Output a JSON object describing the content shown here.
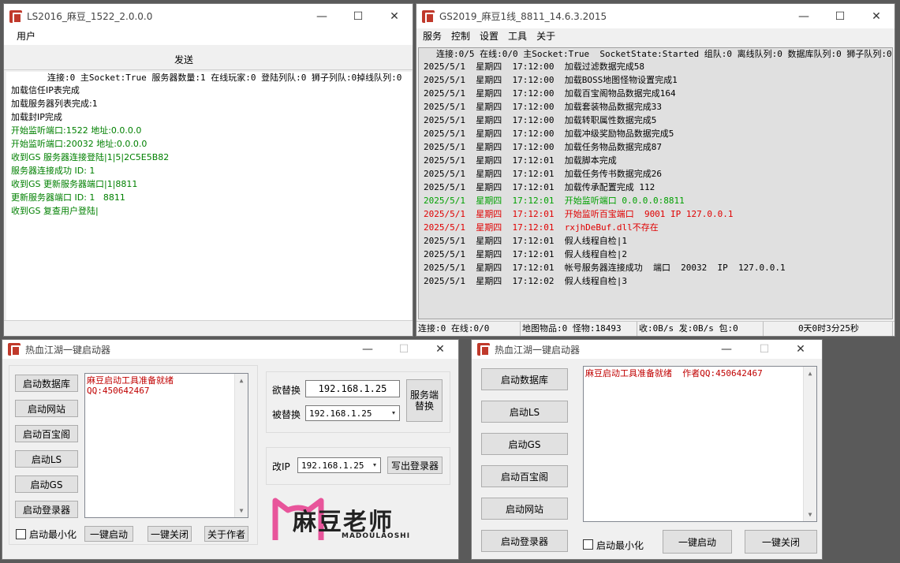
{
  "win_ls": {
    "title": "LS2016_麻豆_1522_2.0.0.0",
    "menu": [
      "用户"
    ],
    "send_label": "发送",
    "status_line": "连接:0 主Socket:True 服务器数量:1 在线玩家:0 登陆列队:0 狮子列队:0掉线队列:0",
    "log": [
      {
        "text": "加载信任IP表完成",
        "color": "#000000"
      },
      {
        "text": "加载服务器列表完成:1",
        "color": "#000000"
      },
      {
        "text": "加载封IP完成",
        "color": "#000000"
      },
      {
        "text": "开始监听端口:1522 地址:0.0.0.0",
        "color": "#008000"
      },
      {
        "text": "开始监听端口:20032 地址:0.0.0.0",
        "color": "#008000"
      },
      {
        "text": "收到GS 服务器连接登陆|1|5|2C5E5B82",
        "color": "#008000"
      },
      {
        "text": "服务器连接成功 ID: 1",
        "color": "#008000"
      },
      {
        "text": "收到GS 更新服务器端口|1|8811",
        "color": "#008000"
      },
      {
        "text": "更新服务器端口 ID: 1   8811",
        "color": "#008000"
      },
      {
        "text": "收到GS 复查用户登陆|",
        "color": "#008000"
      }
    ]
  },
  "win_gs": {
    "title": "GS2019_麻豆1线_8811_14.6.3.2015",
    "menu": [
      "服务",
      "控制",
      "设置",
      "工具",
      "关于"
    ],
    "status_line": "连接:0/5 在线:0/0 主Socket:True  SocketState:Started 组队:0 离线队列:0 数据库队列:0 狮子队列:0",
    "log": [
      {
        "text": "2025/5/1  星期四  17:12:00  加载过滤数据完成58",
        "color": "#000000"
      },
      {
        "text": "2025/5/1  星期四  17:12:00  加载BOSS地图怪物设置完成1",
        "color": "#000000"
      },
      {
        "text": "2025/5/1  星期四  17:12:00  加载百宝阁物品数据完成164",
        "color": "#000000"
      },
      {
        "text": "2025/5/1  星期四  17:12:00  加载套装物品数据完成33",
        "color": "#000000"
      },
      {
        "text": "2025/5/1  星期四  17:12:00  加载转职属性数据完成5",
        "color": "#000000"
      },
      {
        "text": "2025/5/1  星期四  17:12:00  加载冲级奖励物品数据完成5",
        "color": "#000000"
      },
      {
        "text": "2025/5/1  星期四  17:12:00  加载任务物品数据完成87",
        "color": "#000000"
      },
      {
        "text": "2025/5/1  星期四  17:12:01  加载脚本完成",
        "color": "#000000"
      },
      {
        "text": "2025/5/1  星期四  17:12:01  加载任务传书数据完成26",
        "color": "#000000"
      },
      {
        "text": "2025/5/1  星期四  17:12:01  加载传承配置完成 112",
        "color": "#000000"
      },
      {
        "text": "2025/5/1  星期四  17:12:01  开始监听端口 0.0.0.0:8811",
        "color": "#00a000"
      },
      {
        "text": "2025/5/1  星期四  17:12:01  开始监听百宝端口  9001 IP 127.0.0.1",
        "color": "#e00000"
      },
      {
        "text": "2025/5/1  星期四  17:12:01  rxjhDeBuf.dll不存在",
        "color": "#e00000"
      },
      {
        "text": "2025/5/1  星期四  17:12:01  假人线程自检|1",
        "color": "#000000"
      },
      {
        "text": "2025/5/1  星期四  17:12:01  假人线程自检|2",
        "color": "#000000"
      },
      {
        "text": "2025/5/1  星期四  17:12:01  帐号服务器连接成功  端口  20032  IP  127.0.0.1",
        "color": "#000000"
      },
      {
        "text": "2025/5/1  星期四  17:12:02  假人线程自检|3",
        "color": "#000000"
      }
    ],
    "statusbar": [
      "连接:0 在线:0/0",
      "地图物品:0 怪物:18493",
      "收:0B/s 发:0B/s 包:0",
      "0天0时3分25秒"
    ]
  },
  "win_launcher1": {
    "title": "热血江湖一键启动器",
    "buttons": [
      "启动数据库",
      "启动网站",
      "启动百宝阁",
      "启动LS",
      "启动GS",
      "启动登录器"
    ],
    "log": [
      {
        "text": "麻豆启动工具准备就绪",
        "color": "#c00000"
      },
      {
        "text": "QQ:450642467",
        "color": "#c00000"
      }
    ],
    "minimize_label": "启动最小化",
    "one_start": "一键启动",
    "one_close": "一键关闭",
    "about": "关于作者",
    "replace_label": "欲替换",
    "replace_value": "192.168.1.25",
    "replaced_label": "被替换",
    "replaced_value": "192.168.1.25",
    "server_replace_btn": "服务端\n替换",
    "change_ip_label": "改IP",
    "change_ip_value": "192.168.1.25",
    "write_login_btn": "写出登录器",
    "logo_text": "麻豆老师",
    "logo_sub": "MADOULAOSHI"
  },
  "win_launcher2": {
    "title": "热血江湖一键启动器",
    "buttons": [
      "启动数据库",
      "启动LS",
      "启动GS",
      "启动百宝阁",
      "启动网站",
      "启动登录器"
    ],
    "log_text": "麻豆启动工具准备就绪  作者QQ:450642467",
    "minimize_label": "启动最小化",
    "one_start": "一键启动",
    "one_close": "一键关闭"
  },
  "icons": {
    "minimize": "—",
    "maximize": "☐",
    "close": "✕",
    "dropdown": "▾",
    "scroll_up": "▲",
    "scroll_down": "▼"
  }
}
